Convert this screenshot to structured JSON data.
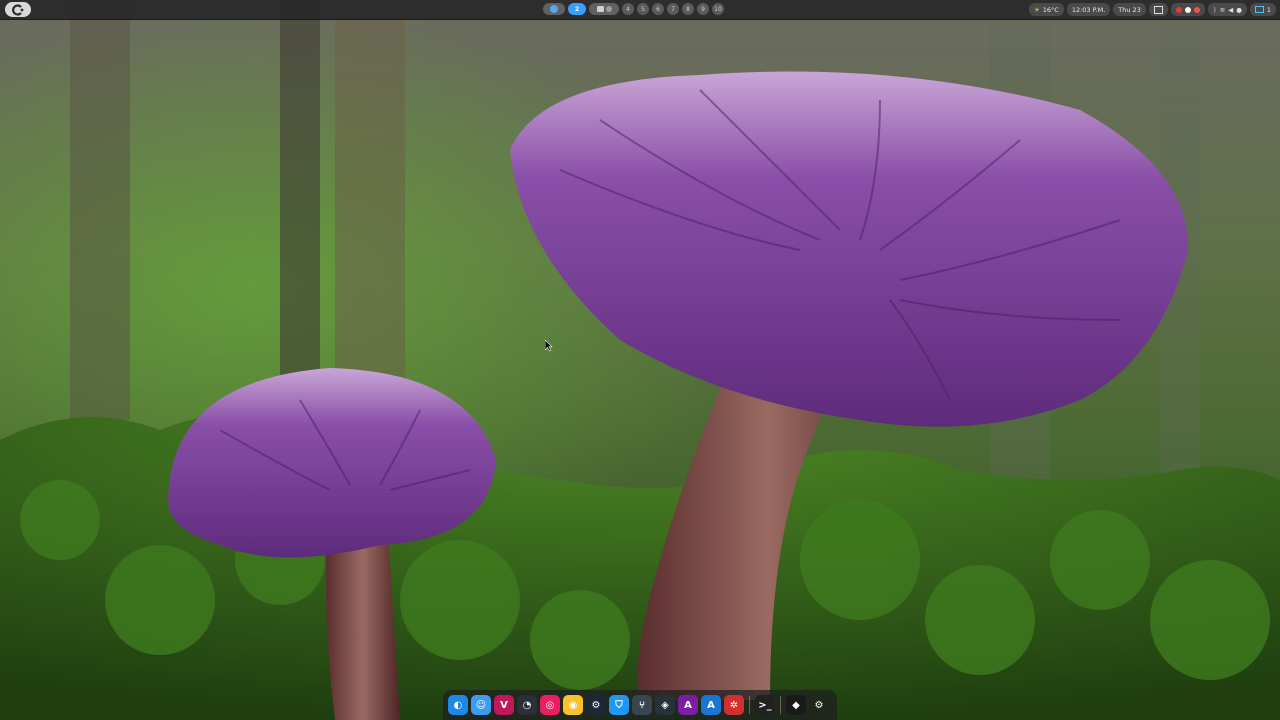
{
  "topbar": {
    "workspaces": [
      {
        "label": "",
        "kind": "pill"
      },
      {
        "label": "2",
        "kind": "active"
      },
      {
        "label": "",
        "kind": "wide"
      },
      {
        "label": "4",
        "kind": "num"
      },
      {
        "label": "5",
        "kind": "num"
      },
      {
        "label": "6",
        "kind": "num"
      },
      {
        "label": "7",
        "kind": "num"
      },
      {
        "label": "8",
        "kind": "num"
      },
      {
        "label": "9",
        "kind": "num"
      },
      {
        "label": "10",
        "kind": "num"
      }
    ],
    "weather": "16°C",
    "time": "12:03 P.M.",
    "date": "Thu 23",
    "battery_label": "1"
  },
  "dock": {
    "icons": [
      {
        "name": "edge-dev-icon",
        "glyph": "◐",
        "color": "#1e88e5"
      },
      {
        "name": "finder-icon",
        "glyph": "☺",
        "color": "#3d9cf0"
      },
      {
        "name": "vivaldi-icon",
        "glyph": "V",
        "color": "#c2185b"
      },
      {
        "name": "steam-like-icon",
        "glyph": "◔",
        "color": "#2a2f3a"
      },
      {
        "name": "target-app-icon",
        "glyph": "◎",
        "color": "#e91e63"
      },
      {
        "name": "zoom-app-icon",
        "glyph": "◉",
        "color": "#fbc02d"
      },
      {
        "name": "steam-icon",
        "glyph": "⚙",
        "color": "#1b2838"
      },
      {
        "name": "shield-icon",
        "glyph": "⛉",
        "color": "#2196f3"
      },
      {
        "name": "git-icon",
        "glyph": "⑂",
        "color": "#37474f"
      },
      {
        "name": "davinci-icon",
        "glyph": "◈",
        "color": "#263238"
      },
      {
        "name": "affinity-icon",
        "glyph": "A",
        "color": "#7b1fa2"
      },
      {
        "name": "appstore-icon",
        "glyph": "A",
        "color": "#1976d2"
      },
      {
        "name": "umbrella-icon",
        "glyph": "✲",
        "color": "#d32f2f"
      },
      {
        "name": "terminal-icon",
        "glyph": ">_",
        "color": "#212121"
      },
      {
        "name": "cube-icon",
        "glyph": "◆",
        "color": "#1a1a1a"
      },
      {
        "name": "settings-icon",
        "glyph": "⚙",
        "color": "transparent"
      }
    ]
  }
}
